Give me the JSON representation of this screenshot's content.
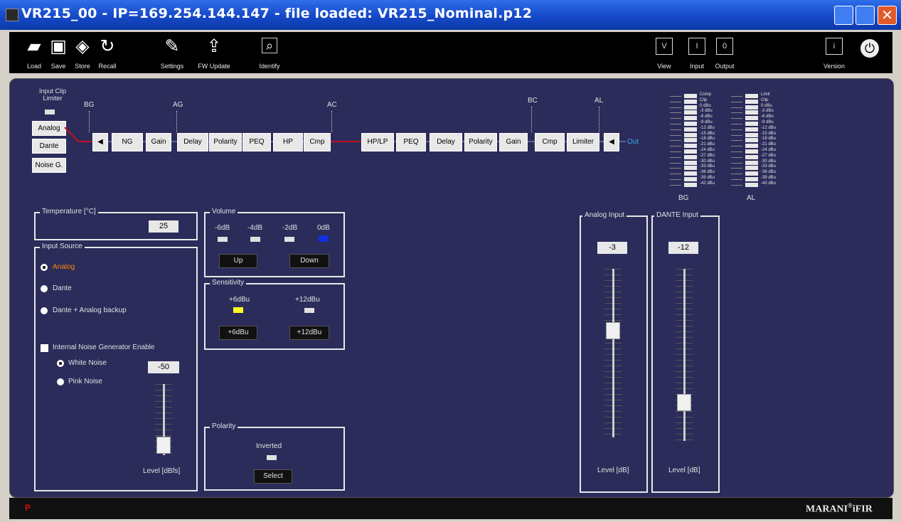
{
  "window": {
    "title": "VR215_00 - IP=169.254.144.147  - file loaded: VR215_Nominal.p12",
    "close_glyph": "✕"
  },
  "toolbar": {
    "load": "Load",
    "save": "Save",
    "store": "Store",
    "recall": "Recall",
    "settings": "Settings",
    "fw_update": "FW Update",
    "identify": "Identify",
    "view": "View",
    "input": "Input",
    "output": "Output",
    "version": "Version",
    "view_box": "V",
    "input_box": "I",
    "output_box": "0",
    "version_box": "i"
  },
  "input_clip": {
    "label_line1": "Input Clip",
    "label_line2": "Limiter"
  },
  "sources": {
    "analog": "Analog",
    "dante": "Dante",
    "noise": "Noise G."
  },
  "chain_markers": {
    "bg": "BG",
    "ag": "AG",
    "ac": "AC",
    "bc": "BC",
    "al": "AL"
  },
  "chain": {
    "input_blocks": [
      "NG",
      "Gain",
      "Delay",
      "Polarity",
      "PEQ",
      "HP",
      "Cmp"
    ],
    "output_blocks": [
      "HP/LP",
      "PEQ",
      "Delay",
      "Polarity",
      "Gain",
      "Cmp",
      "Limiter"
    ],
    "out_label": "Out"
  },
  "meters": {
    "bg_label": "BG",
    "al_label": "AL",
    "left_labels": [
      "Comp",
      "Clip",
      "0 dBu",
      "-3 dBu",
      "-6 dBu",
      "-9 dBu",
      "-12 dBu",
      "-15 dBu",
      "-18 dBu",
      "-21 dBu",
      "-24 dBu",
      "-27 dBu",
      "-30 dBu",
      "-33 dBu",
      "-36 dBu",
      "-39 dBu",
      "-42 dBu"
    ],
    "right_labels": [
      "Limit",
      "Clip",
      "0 dBu",
      "-3 dBu",
      "-6 dBu",
      "-9 dBu",
      "-12 dBu",
      "-15 dBu",
      "-18 dBu",
      "-21 dBu",
      "-24 dBu",
      "-27 dBu",
      "-30 dBu",
      "-33 dBu",
      "-36 dBu",
      "-39 dBu",
      "-42 dBu"
    ]
  },
  "temperature": {
    "title": "Temperature [°C]",
    "value": "25"
  },
  "input_source": {
    "title": "Input Source",
    "analog": "Analog",
    "dante": "Dante",
    "dante_backup": "Dante + Analog backup",
    "noise_enable": "Internal Noise Generator Enable",
    "white": "White Noise",
    "pink": "Pink Noise",
    "noise_level": "-50",
    "level_label": "Level [dBfs]",
    "noise_level_fraction": 0.05
  },
  "volume": {
    "title": "Volume",
    "levels": [
      "-6dB",
      "-4dB",
      "-2dB",
      "0dB"
    ],
    "up": "Up",
    "down": "Down"
  },
  "sensitivity": {
    "title": "Sensitivity",
    "low": "+6dBu",
    "high": "+12dBu",
    "btn_low": "+6dBu",
    "btn_high": "+12dBu"
  },
  "polarity": {
    "title": "Polarity",
    "state": "Inverted",
    "select": "Select"
  },
  "analog_input": {
    "title": "Analog Input",
    "value": "-3",
    "level_label": "Level [dB]",
    "level_fraction": 0.65
  },
  "dante_input": {
    "title": "DANTE Input",
    "value": "-12",
    "level_label": "Level [dB]",
    "level_fraction": 0.2
  },
  "status": {
    "indicator": "P",
    "brand": "MARANI",
    "brand_reg": "®",
    "brand_suffix": "iFIR"
  },
  "colors": {
    "titlebar": "#1548c8",
    "panel": "#2b2c5a",
    "accent_orange": "#ff8c00",
    "led_blue": "#1030e0",
    "led_yellow": "#ffff20",
    "status_red": "#d01010"
  }
}
